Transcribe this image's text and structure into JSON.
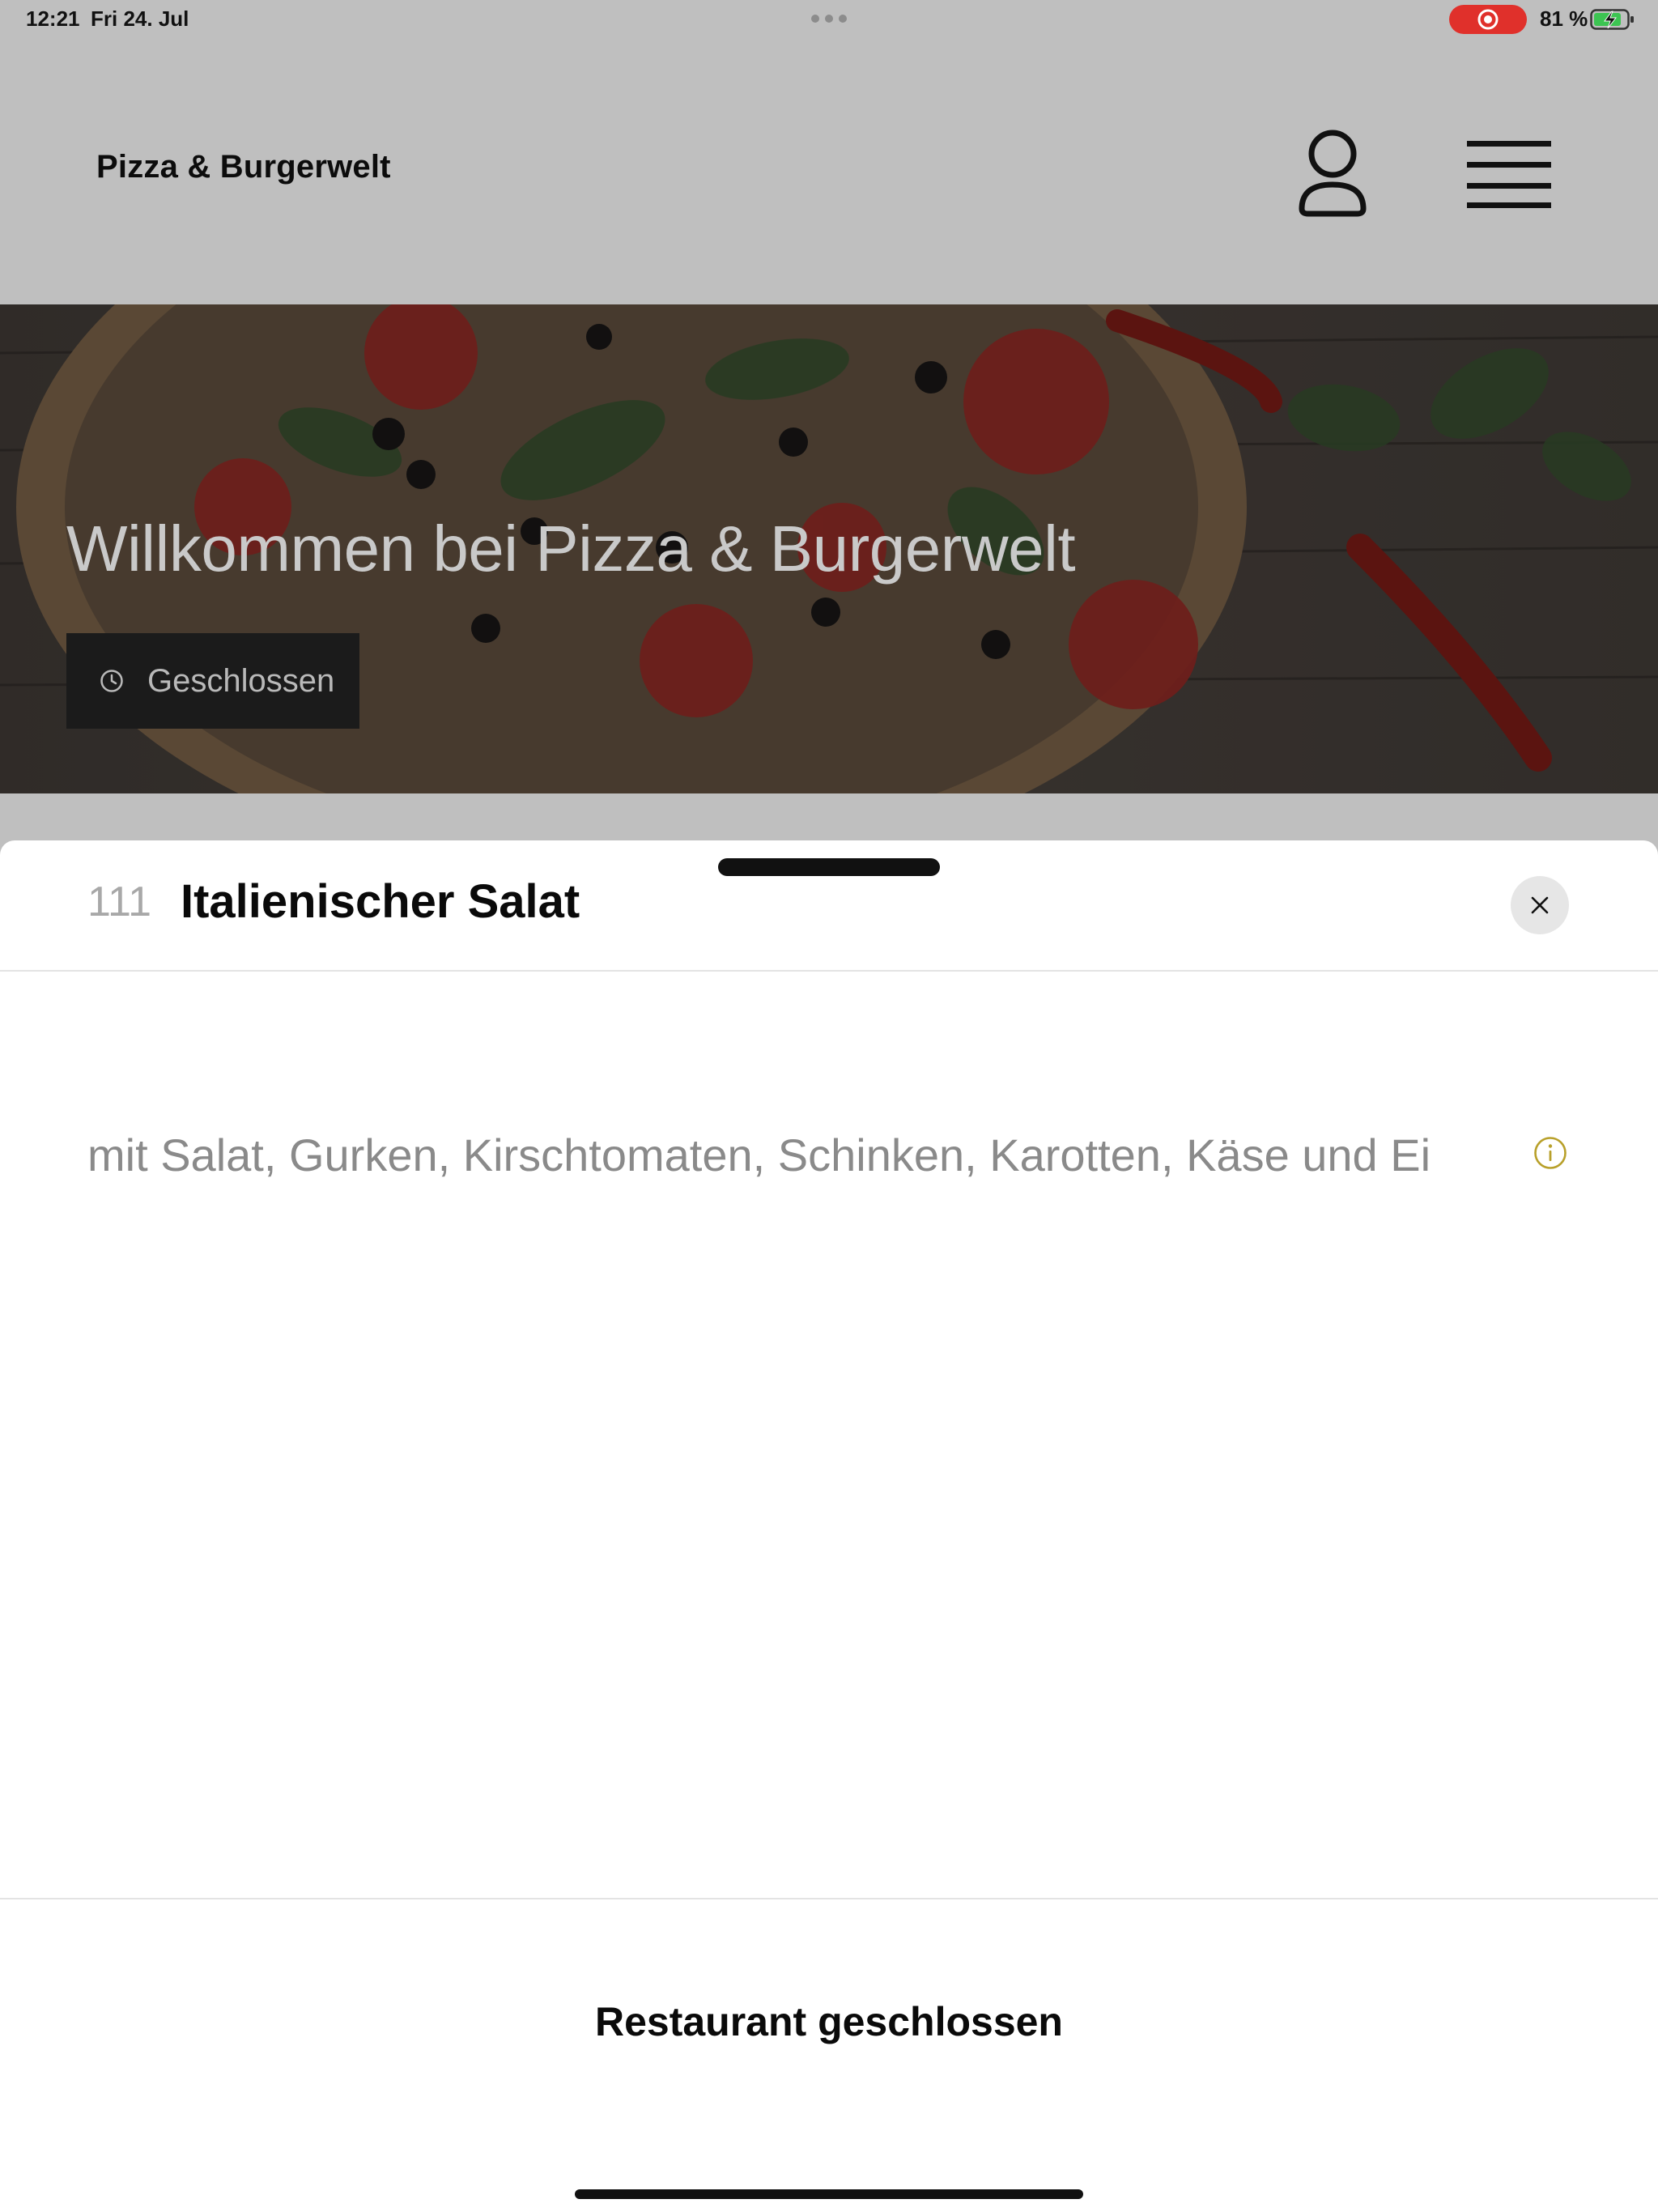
{
  "status_bar": {
    "time": "12:21",
    "date": "Fri 24. Jul",
    "battery": "81 %",
    "record_color": "#e0302b"
  },
  "header": {
    "brand": "Pizza & Burgerwelt",
    "icons": [
      "user-icon",
      "hamburger-menu-icon"
    ]
  },
  "hero": {
    "title": "Willkommen bei Pizza & Burgerwelt",
    "status_label": "Geschlossen",
    "status_icon": "clock-icon"
  },
  "sheet": {
    "item_number": "111",
    "item_title": "Italienischer Salat",
    "description": "mit Salat, Gurken, Kirschtomaten, Schinken, Karotten, Käse und Ei",
    "info_icon_color": "#b8a02a",
    "action_label": "Restaurant geschlossen"
  }
}
